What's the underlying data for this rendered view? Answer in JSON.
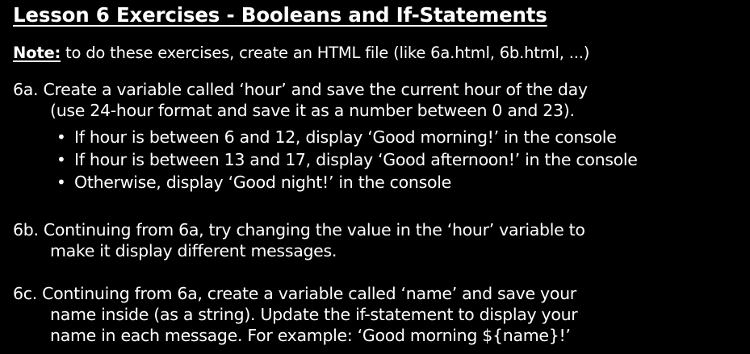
{
  "title": "Lesson 6 Exercises - Booleans and If-Statements",
  "note": {
    "label": "Note:",
    "text": " to do these exercises, create an HTML file (like 6a.html, 6b.html, ...)"
  },
  "ex6a": {
    "line1": "6a. Create a variable called ‘hour’ and save the current hour of the day",
    "line2": "(use 24-hour format and save it as a number between 0 and 23).",
    "bullets": [
      "If hour is between 6 and 12, display ‘Good morning!’ in the console",
      "If hour is between 13 and 17, display ‘Good afternoon!’ in the console",
      "Otherwise, display ‘Good night!’ in the console"
    ],
    "bullet_symbol": "•"
  },
  "ex6b": {
    "line1": "6b. Continuing from 6a, try changing the value in the ‘hour’ variable to",
    "line2": "make it display different messages."
  },
  "ex6c": {
    "line1": "6c. Continuing from 6a, create a variable called ‘name’ and save your",
    "line2": "name inside (as a string). Update the if-statement to display your",
    "line3": "name in each message. For example: ‘Good morning ${name}!’"
  }
}
